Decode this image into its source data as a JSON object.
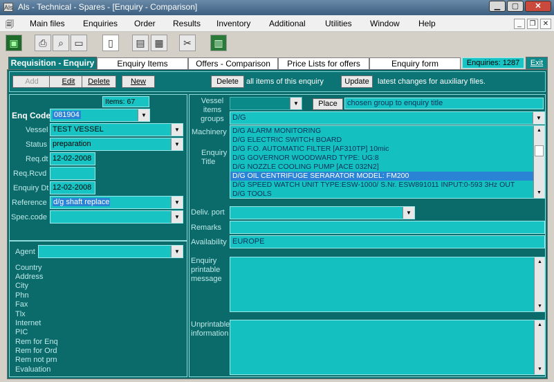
{
  "window": {
    "title": "Als - Technical - Spares - [Enquiry -  Comparison]",
    "app_icon": "app-icon",
    "controls": [
      "minimize-icon",
      "maximize-icon",
      "close-icon"
    ]
  },
  "menu": {
    "items": [
      "Main files",
      "Enquiries",
      "Order",
      "Results",
      "Inventory",
      "Additional",
      "Utilities",
      "Window",
      "Help"
    ]
  },
  "tabs": [
    {
      "label": "Requisition - Enquiry",
      "active": true
    },
    {
      "label": "Enquiry Items",
      "active": false
    },
    {
      "label": "Offers - Comparison",
      "active": false
    },
    {
      "label": "Price Lists for offers",
      "active": false
    },
    {
      "label": "Enquiry form",
      "active": false
    }
  ],
  "enquiries_count": "Enquiries: 1287",
  "exit_label": "Exit",
  "actions": {
    "add": "Add",
    "edit": "Edit",
    "delete": "Delete",
    "new": "New",
    "delete_all": "Delete",
    "delete_all_text": "all items of this enquiry",
    "update": "Update",
    "update_text": "latest changes for auxiliary files."
  },
  "left": {
    "items_count": "Items: 67",
    "enq_code_label": "Enq Code",
    "enq_code": "081904",
    "vessel_label": "Vessel",
    "vessel": "TEST VESSEL",
    "status_label": "Status",
    "status": "preparation",
    "req_dt_label": "Req.dt",
    "req_dt": "12-02-2008",
    "req_rcvd_label": "Req.Rcvd",
    "req_rcvd": "",
    "enquiry_dt_label": "Enquiry Dt",
    "enquiry_dt": "12-02-2008",
    "reference_label": "Reference",
    "reference": "d/g shaft replace",
    "spec_code_label": "Spec.code",
    "spec_code": "",
    "agent_label": "Agent",
    "agent": "",
    "agent_fields": [
      "Country",
      "Address",
      "City",
      "Phn",
      "Fax",
      "Tlx",
      "Internet",
      "PIC",
      "Rem for Enq",
      "Rem for Ord",
      "Rem not prn",
      "Evaluation"
    ]
  },
  "right": {
    "vessel_items_groups_label": "Vessel items groups",
    "place_button": "Place",
    "place_text": "chosen group to enquiry title",
    "group_value": "D/G",
    "machinery_label": "Machinery",
    "enquiry_title_label": "Enquiry Title",
    "machinery_list": [
      "D/G ALARM MONITORING",
      "D/G ELECTRIC SWITCH BOARD",
      "D/G F.O. AUTOMATIC FILTER  [AF310TP] 10mic",
      "D/G GOVERNOR WOODWARD  TYPE: UG:8",
      "D/G NOZZLE COOLING PUMP [ACE 032N2]",
      "D/G OIL CENTRIFUGE SERARATOR MODEL: FM200",
      "D/G SPEED WATCH UNIT TYPE:ESW-1000/ S.Nr. ESW891011  INPUT:0-593  3Hz  OUT",
      "D/G TOOLS"
    ],
    "selected_index": 5,
    "deliv_port_label": "Deliv. port",
    "deliv_port": "",
    "remarks_label": "Remarks",
    "remarks": "",
    "availability_label": "Availability",
    "availability": "EUROPE",
    "enquiry_printable_label": "Enquiry printable message",
    "unprintable_label": "Unprintable information"
  }
}
